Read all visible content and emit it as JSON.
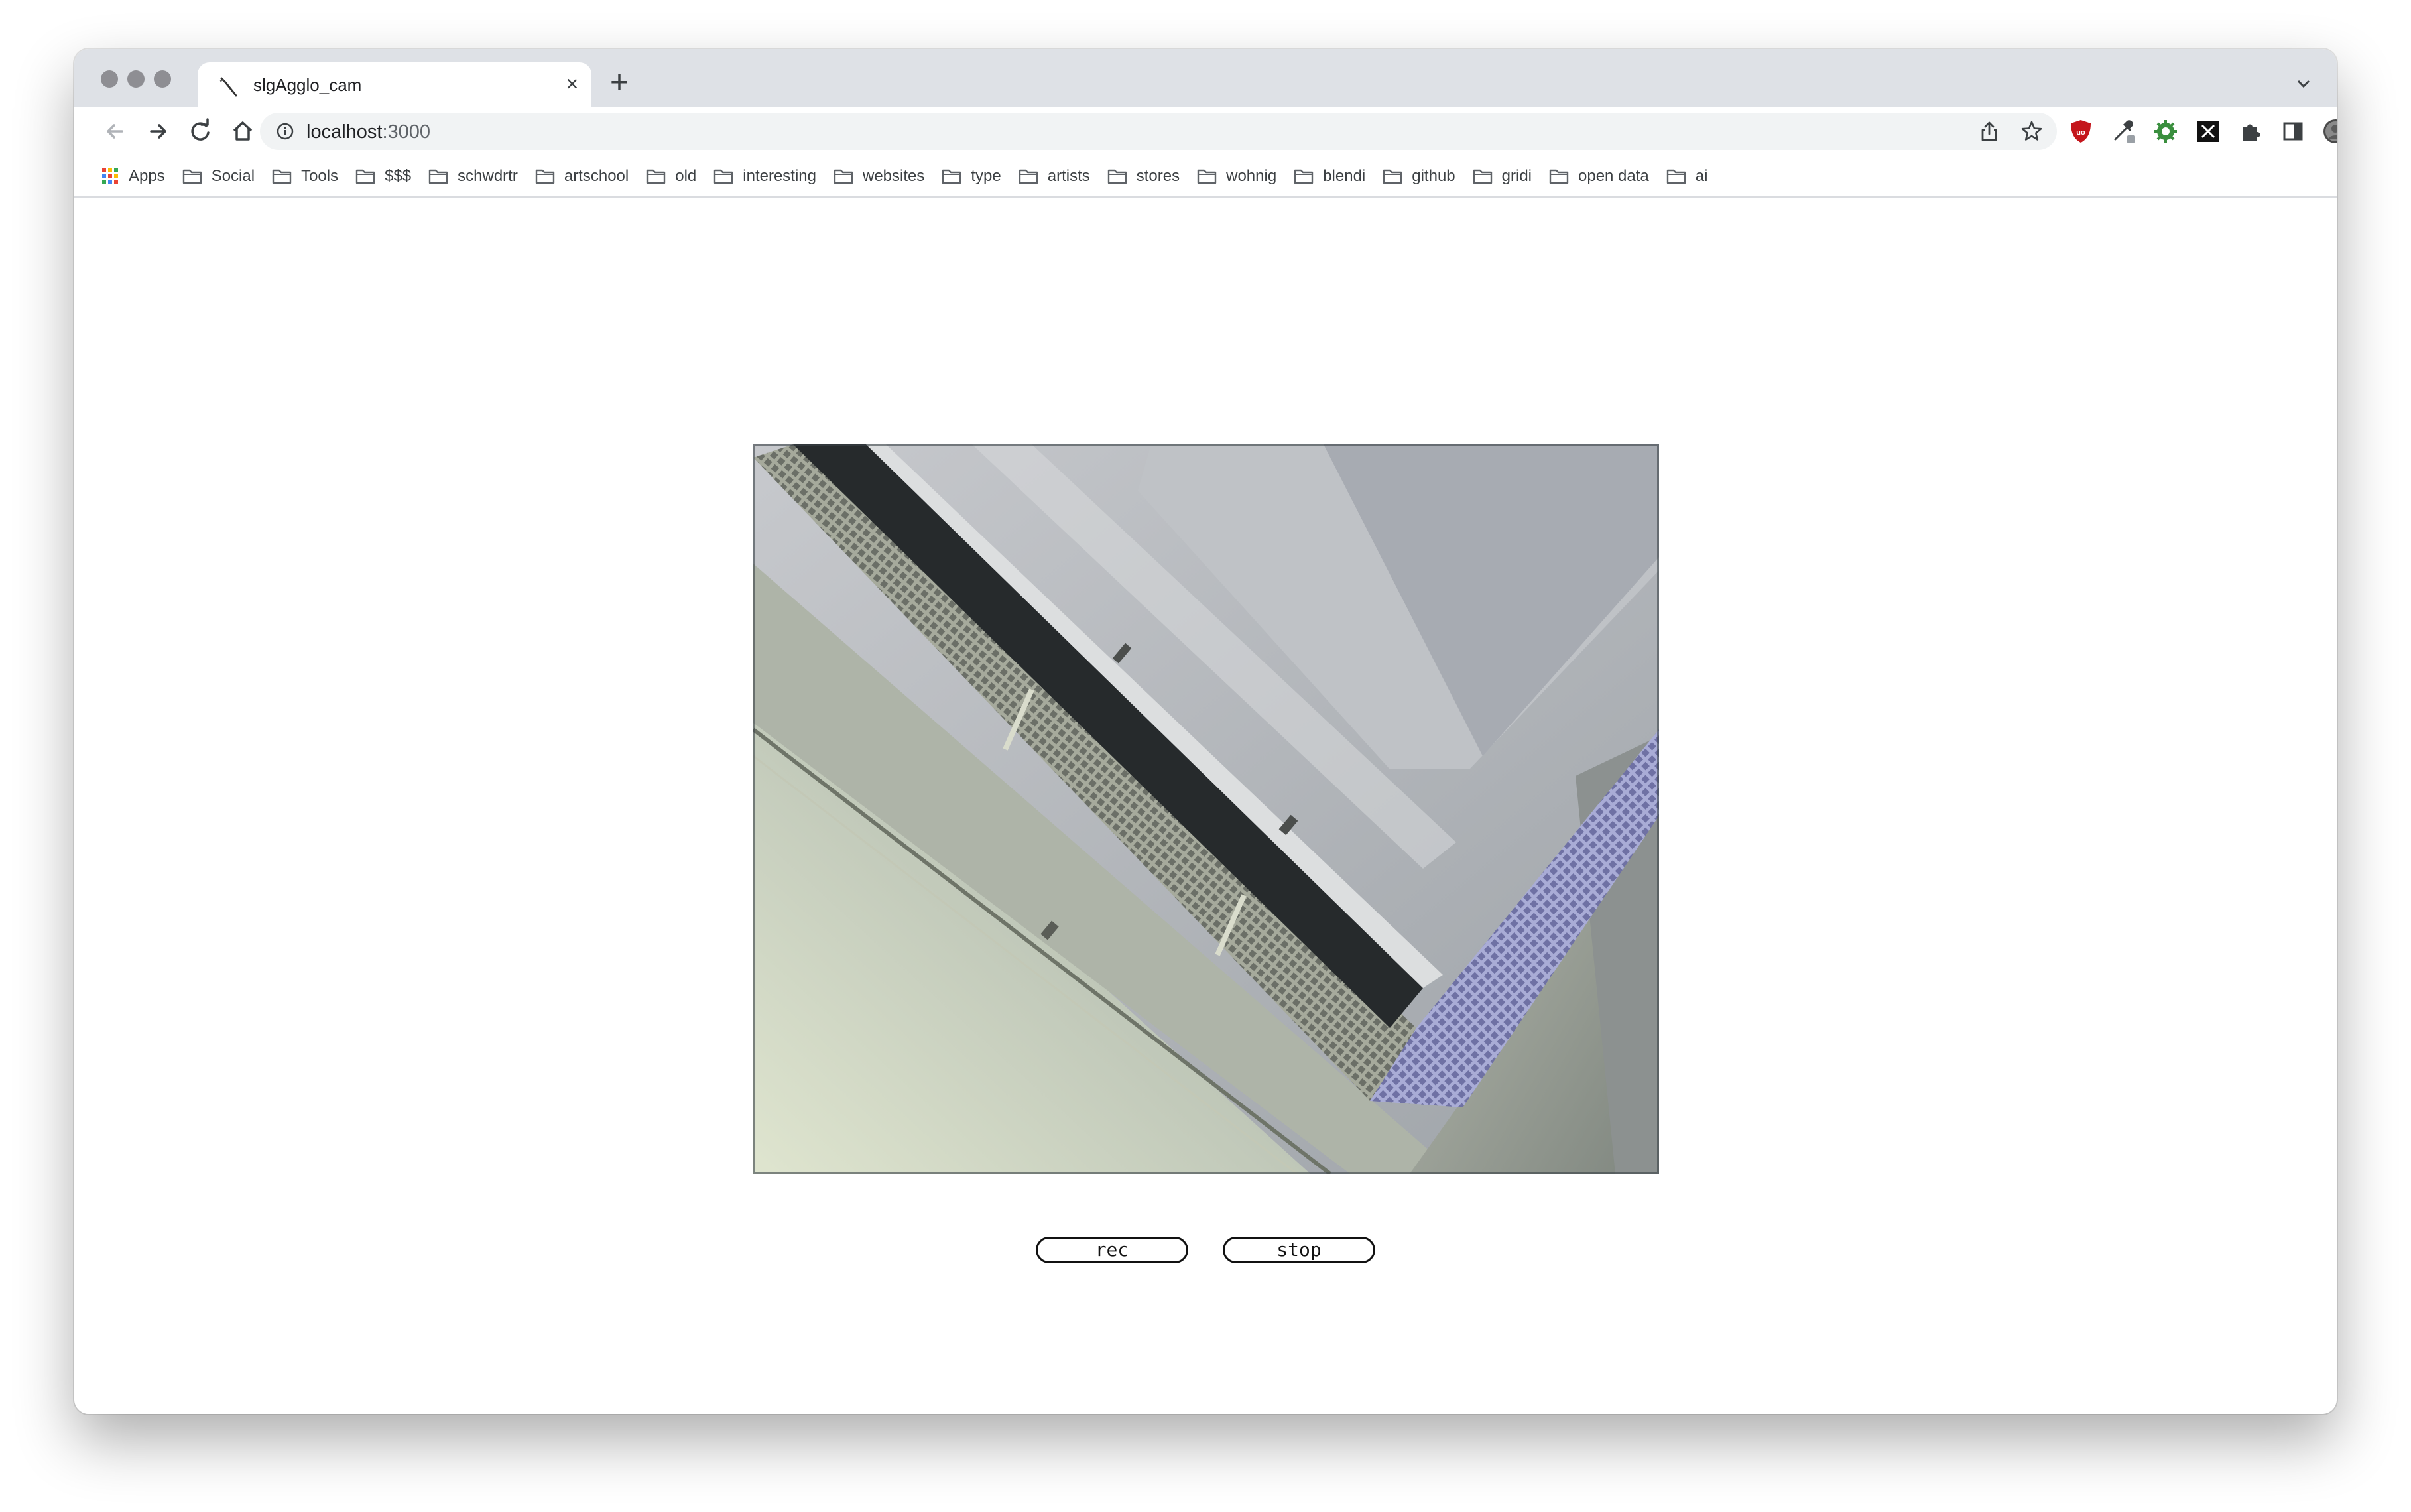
{
  "browser": {
    "tab": {
      "title": "slgAgglo_cam",
      "close_glyph": "×"
    },
    "new_tab_glyph": "+",
    "address": {
      "host": "localhost",
      "port": ":3000"
    },
    "bookmarks": [
      {
        "label": "Apps",
        "icon": "apps-grid-icon"
      },
      {
        "label": "Social",
        "icon": "folder-icon"
      },
      {
        "label": "Tools",
        "icon": "folder-icon"
      },
      {
        "label": "$$$",
        "icon": "folder-icon"
      },
      {
        "label": "schwdrtr",
        "icon": "folder-icon"
      },
      {
        "label": "artschool",
        "icon": "folder-icon"
      },
      {
        "label": "old",
        "icon": "folder-icon"
      },
      {
        "label": "interesting",
        "icon": "folder-icon"
      },
      {
        "label": "websites",
        "icon": "folder-icon"
      },
      {
        "label": "type",
        "icon": "folder-icon"
      },
      {
        "label": "artists",
        "icon": "folder-icon"
      },
      {
        "label": "stores",
        "icon": "folder-icon"
      },
      {
        "label": "wohnig",
        "icon": "folder-icon"
      },
      {
        "label": "blendi",
        "icon": "folder-icon"
      },
      {
        "label": "github",
        "icon": "folder-icon"
      },
      {
        "label": "gridi",
        "icon": "folder-icon"
      },
      {
        "label": "open data",
        "icon": "folder-icon"
      },
      {
        "label": "ai",
        "icon": "folder-icon"
      }
    ]
  },
  "page": {
    "rec_label": "rec",
    "stop_label": "stop"
  },
  "colors": {
    "tabstrip": "#dee1e6",
    "omnibox": "#f1f3f4",
    "ublock_red": "#c4161c"
  }
}
